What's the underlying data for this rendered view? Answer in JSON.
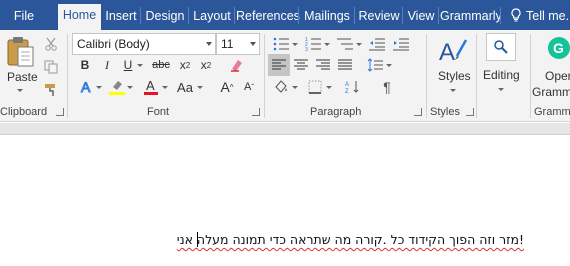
{
  "tabs": [
    {
      "label": "File"
    },
    {
      "label": "Home",
      "active": true
    },
    {
      "label": "Insert"
    },
    {
      "label": "Design"
    },
    {
      "label": "Layout"
    },
    {
      "label": "References"
    },
    {
      "label": "Mailings"
    },
    {
      "label": "Review"
    },
    {
      "label": "View"
    },
    {
      "label": "Grammarly"
    }
  ],
  "tellme": "Tell me...",
  "clipboard": {
    "paste_label": "Paste",
    "group_label": "Clipboard"
  },
  "font": {
    "family": "Calibri (Body)",
    "size": "11",
    "group_label": "Font",
    "aa_label": "Aa"
  },
  "paragraph": {
    "group_label": "Paragraph"
  },
  "styles": {
    "label": "Styles",
    "group_label": "Styles"
  },
  "editing": {
    "label": "Editing"
  },
  "grammarly": {
    "open_label_1": "Open",
    "open_label_2": "Gramm",
    "group_label": "Gramma"
  },
  "document": {
    "text": "!מזר וזה הפוך הקידוד כל .קורה מה שתראה כדי תמונה מעלה אני"
  },
  "colors": {
    "tab_bar": "#2b579a",
    "highlight": "#ffff00",
    "font_color": "#e81123"
  }
}
